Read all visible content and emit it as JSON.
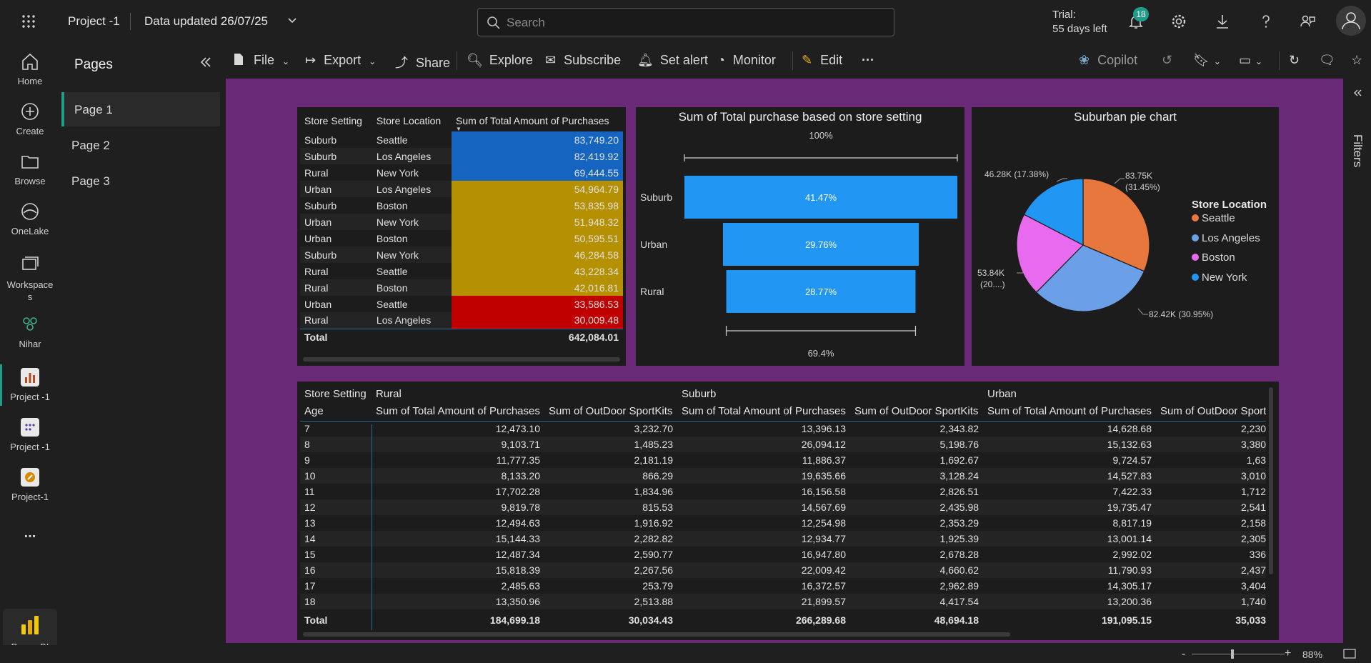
{
  "topbar": {
    "app_title": "Project -1",
    "data_updated": "Data updated 26/07/25",
    "search_placeholder": "Search",
    "trial_line1": "Trial:",
    "trial_line2": "55 days left",
    "notification_count": "18"
  },
  "leftnav": {
    "items": [
      {
        "label": "Home",
        "icon": "home-icon"
      },
      {
        "label": "Create",
        "icon": "plus-circle-icon"
      },
      {
        "label": "Browse",
        "icon": "folder-icon"
      },
      {
        "label": "OneLake",
        "icon": "onelake-icon"
      },
      {
        "label": "Workspaces",
        "icon": "workspaces-icon"
      },
      {
        "label": "Nihar",
        "icon": "people-icon"
      },
      {
        "label": "Project -1",
        "icon": "report-icon"
      },
      {
        "label": "Project -1",
        "icon": "dashboard-icon"
      },
      {
        "label": "Project-1",
        "icon": "semantic-model-icon"
      }
    ],
    "more": "...",
    "brand": "Power BI"
  },
  "pages_pane": {
    "title": "Pages",
    "pages": [
      "Page 1",
      "Page 2",
      "Page 3"
    ]
  },
  "toolbar": {
    "file": "File",
    "export": "Export",
    "share": "Share",
    "explore": "Explore",
    "subscribe": "Subscribe",
    "set_alert": "Set alert",
    "monitor": "Monitor",
    "edit": "Edit",
    "more": "···",
    "copilot": "Copilot"
  },
  "right_pane": {
    "filters": "Filters"
  },
  "status": {
    "zoom": "88%",
    "minus": "-",
    "plus": "+"
  },
  "table1": {
    "headers": [
      "Store Setting",
      "Store Location",
      "Sum of Total Amount of Purchases"
    ],
    "rows": [
      {
        "setting": "Suburb",
        "location": "Seattle",
        "value": "83,749.20",
        "color": "#1565c0"
      },
      {
        "setting": "Suburb",
        "location": "Los Angeles",
        "value": "82,419.92",
        "color": "#1565c0"
      },
      {
        "setting": "Rural",
        "location": "New York",
        "value": "69,444.55",
        "color": "#1565c0"
      },
      {
        "setting": "Urban",
        "location": "Los Angeles",
        "value": "54,964.79",
        "color": "#b59000"
      },
      {
        "setting": "Suburb",
        "location": "Boston",
        "value": "53,835.98",
        "color": "#b59000"
      },
      {
        "setting": "Urban",
        "location": "New York",
        "value": "51,948.32",
        "color": "#b59000"
      },
      {
        "setting": "Urban",
        "location": "Boston",
        "value": "50,595.51",
        "color": "#b59000"
      },
      {
        "setting": "Suburb",
        "location": "New York",
        "value": "46,284.58",
        "color": "#b59000"
      },
      {
        "setting": "Rural",
        "location": "Seattle",
        "value": "43,228.34",
        "color": "#b59000"
      },
      {
        "setting": "Rural",
        "location": "Boston",
        "value": "42,016.81",
        "color": "#b59000"
      },
      {
        "setting": "Urban",
        "location": "Seattle",
        "value": "33,586.53",
        "color": "#c00000"
      },
      {
        "setting": "Rural",
        "location": "Los Angeles",
        "value": "30,009.48",
        "color": "#c00000"
      }
    ],
    "total_label": "Total",
    "total_value": "642,084.01"
  },
  "funnel": {
    "title": "Sum of Total purchase based on store setting",
    "top_label": "100%",
    "bottom_label": "69.4%"
  },
  "pie": {
    "title": "Suburban pie chart",
    "legend_title": "Store Location",
    "labels": {
      "seattle": [
        "83.75K",
        "(31.45%)"
      ],
      "los_angeles": "82.42K (30.95%)",
      "boston": [
        "53.84K",
        "(20....)"
      ],
      "new_york": "46.28K (17.38%)"
    }
  },
  "matrix": {
    "row_header_1": "Store Setting",
    "row_header_2": "Age",
    "groups": [
      "Rural",
      "Suburb",
      "Urban"
    ],
    "measures": [
      "Sum of Total Amount of Purchases",
      "Sum of OutDoor SportKits"
    ],
    "rows": [
      [
        "7",
        "12,473.10",
        "3,232.70",
        "13,396.13",
        "2,343.82",
        "14,628.68",
        "2,230"
      ],
      [
        "8",
        "9,103.71",
        "1,485.23",
        "26,094.12",
        "5,198.76",
        "15,132.63",
        "3,380"
      ],
      [
        "9",
        "11,777.35",
        "2,181.19",
        "11,886.37",
        "1,692.67",
        "9,724.57",
        "1,63"
      ],
      [
        "10",
        "8,133.20",
        "866.29",
        "19,635.66",
        "3,128.24",
        "14,527.83",
        "3,010"
      ],
      [
        "11",
        "17,702.28",
        "1,834.96",
        "16,156.58",
        "2,826.51",
        "7,422.33",
        "1,712"
      ],
      [
        "12",
        "9,819.78",
        "815.53",
        "14,567.69",
        "2,435.98",
        "19,735.47",
        "2,541"
      ],
      [
        "13",
        "12,494.63",
        "1,916.92",
        "12,254.98",
        "2,353.29",
        "8,817.19",
        "2,158"
      ],
      [
        "14",
        "15,144.33",
        "2,282.82",
        "12,934.77",
        "1,925.39",
        "13,001.14",
        "2,305"
      ],
      [
        "15",
        "12,487.34",
        "2,590.77",
        "16,947.80",
        "2,678.28",
        "2,992.02",
        "336"
      ],
      [
        "16",
        "15,818.39",
        "2,267.56",
        "22,009.42",
        "4,660.62",
        "11,790.93",
        "2,437"
      ],
      [
        "17",
        "2,485.63",
        "253.79",
        "16,372.57",
        "2,962.89",
        "14,305.17",
        "3,404"
      ],
      [
        "18",
        "13,350.96",
        "2,513.88",
        "21,899.57",
        "4,417.54",
        "13,200.36",
        "1,740"
      ]
    ],
    "total": [
      "Total",
      "184,699.18",
      "30,034.43",
      "266,289.68",
      "48,694.18",
      "191,095.15",
      "35,033"
    ]
  },
  "chart_data": [
    {
      "type": "bar",
      "title": "Sum of Total purchase based on store setting",
      "categories": [
        "Suburb",
        "Urban",
        "Rural"
      ],
      "values": [
        266289.68,
        191095.15,
        184699.18
      ],
      "data_labels": [
        "41.47%",
        "29.76%",
        "28.77%"
      ],
      "color": "#2196f3"
    },
    {
      "type": "pie",
      "title": "Suburban pie chart",
      "legend_title": "Store Location",
      "legend_position": "right",
      "categories": [
        "Seattle",
        "Los Angeles",
        "Boston",
        "New York"
      ],
      "values": [
        83749.2,
        82419.92,
        53835.98,
        46284.58
      ],
      "colors": [
        "#e8773d",
        "#6b9fe8",
        "#e86bef",
        "#2196f3"
      ]
    }
  ]
}
